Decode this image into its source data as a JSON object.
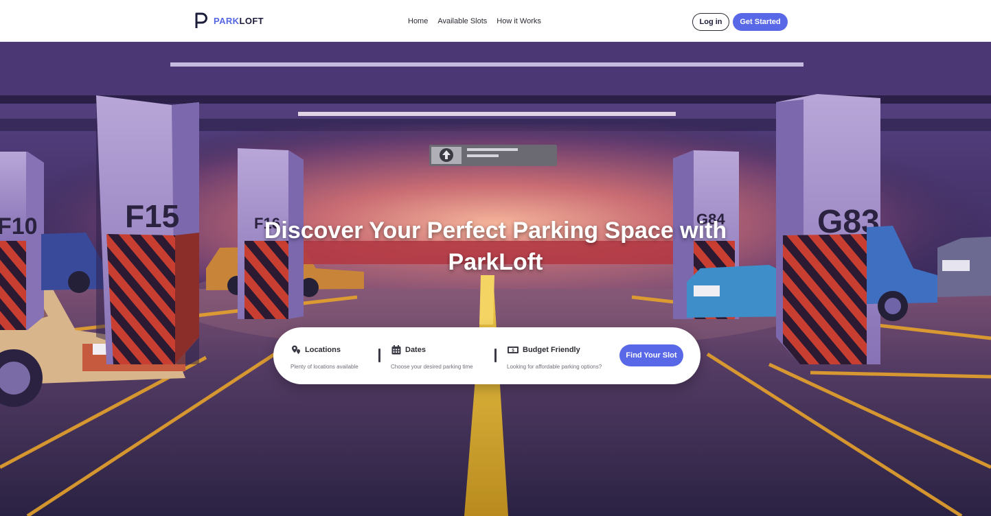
{
  "brand": {
    "name_accent": "PARK",
    "name_rest": "LOFT",
    "logo_letter": "P"
  },
  "nav": [
    {
      "label": "Home"
    },
    {
      "label": "Available Slots"
    },
    {
      "label": "How it Works"
    }
  ],
  "auth": {
    "login_label": "Log in",
    "start_label": "Get Started"
  },
  "hero": {
    "title_line1": "Discover Your Perfect Parking Space with",
    "title_line2": "ParkLoft",
    "signs": {
      "pillar_1": "F15",
      "pillar_2": "F16",
      "pillar_3": "G84",
      "pillar_4": "G83",
      "pillar_left": "F10"
    }
  },
  "search": {
    "options": [
      {
        "title": "Locations",
        "description": "Plenty of locations available",
        "icon": "map-pin-icon"
      },
      {
        "title": "Dates",
        "description": "Choose your desired parking time",
        "icon": "calendar-icon"
      },
      {
        "title": "Budget Friendly",
        "description": "Looking for affordable parking options?",
        "icon": "money-icon"
      }
    ],
    "cta_label": "Find Your Slot"
  },
  "colors": {
    "accent": "#5868e6",
    "brand_dark": "#1c1d3a"
  }
}
